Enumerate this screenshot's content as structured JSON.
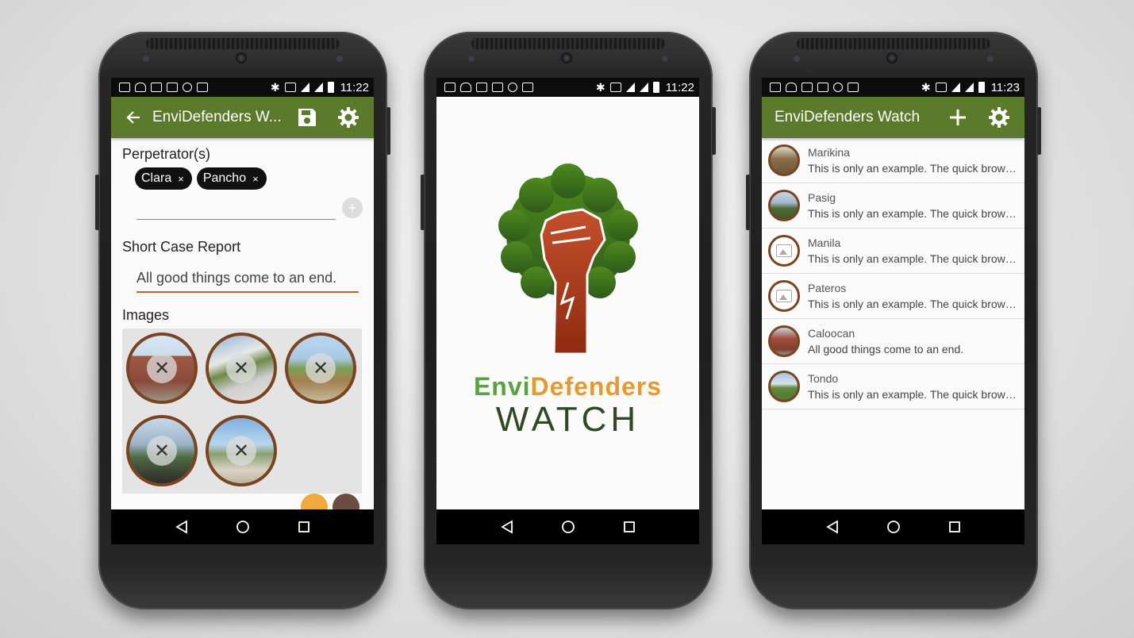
{
  "status_bar": {
    "phone1_time": "11:22",
    "phone2_time": "11:22",
    "phone3_time": "11:23"
  },
  "nav": {
    "back_icon": "nav-back-icon",
    "home_icon": "nav-home-icon",
    "recents_icon": "nav-recents-icon"
  },
  "edit_screen": {
    "title": "EnviDefenders W...",
    "perpetrators_label": "Perpetrator(s)",
    "chips": [
      {
        "label": "Clara",
        "remove": "×"
      },
      {
        "label": "Pancho",
        "remove": "×"
      }
    ],
    "add_chip_label": "+",
    "report_label": "Short Case Report",
    "report_value": "All good things come to an end.",
    "images_label": "Images",
    "delete_glyph": "✕",
    "fab_colors": [
      "#f2a93b",
      "#6d4c41"
    ]
  },
  "splash_screen": {
    "brand_part1": "Envi",
    "brand_part2": "Defenders",
    "brand_sub": "WATCH",
    "colors": {
      "green": "#58a33c",
      "orange": "#e69a2b",
      "dark_green": "#2f4a22"
    }
  },
  "list_screen": {
    "title": "EnviDefenders Watch",
    "items": [
      {
        "title": "Marikina",
        "subtitle": "This is only an example. The quick brown fox jumps over the lazy dog."
      },
      {
        "title": "Pasig",
        "subtitle": "This is only an example. The quick brown fox jumps over the lazy dog."
      },
      {
        "title": "Manila",
        "subtitle": "This is only an example. The quick brown fox jumps over the lazy dog."
      },
      {
        "title": "Pateros",
        "subtitle": "This is only an example. The quick brown fox jumps over the lazy dog."
      },
      {
        "title": "Caloocan",
        "subtitle": "All good things come to an end."
      },
      {
        "title": "Tondo",
        "subtitle": "This is only an example. The quick brown fox jumps over the lazy dog."
      }
    ]
  },
  "colors": {
    "appbar": "#5b7a2b",
    "avatar_border": "#7a4421",
    "input_accent": "#c0632b"
  }
}
